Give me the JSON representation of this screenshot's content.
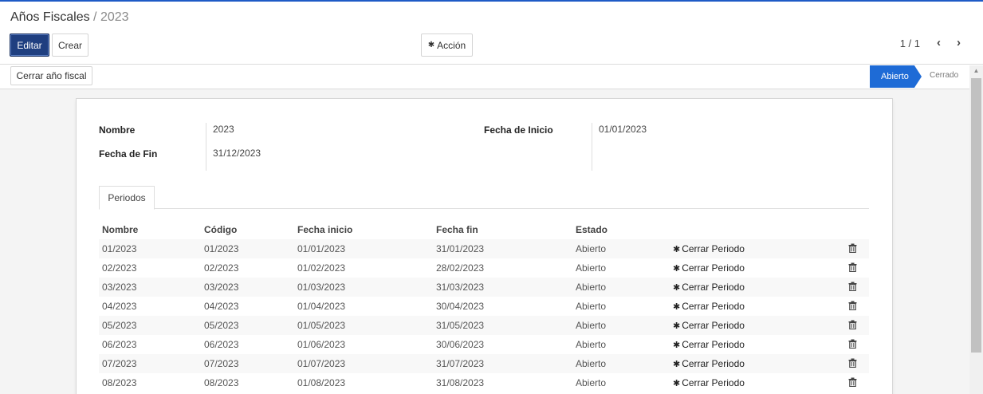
{
  "breadcrumb": {
    "parent": "Años Fiscales",
    "separator": "/",
    "current": "2023"
  },
  "toolbar": {
    "edit_label": "Editar",
    "create_label": "Crear",
    "action_label": "Acción",
    "action_icon": "gear-icon"
  },
  "pager": {
    "value": "1 / 1",
    "prev_icon": "chevron-left-icon",
    "next_icon": "chevron-right-icon"
  },
  "statusbar": {
    "close_year_label": "Cerrar año fiscal",
    "stages": [
      "Abierto",
      "Cerrado"
    ],
    "active_stage": "Abierto"
  },
  "form": {
    "name_label": "Nombre",
    "name_value": "2023",
    "end_label": "Fecha de Fin",
    "end_value": "31/12/2023",
    "start_label": "Fecha de Inicio",
    "start_value": "01/01/2023"
  },
  "tabs": [
    "Periodos"
  ],
  "table": {
    "columns": [
      "Nombre",
      "Código",
      "Fecha inicio",
      "Fecha fin",
      "Estado"
    ],
    "action_label": "Cerrar Periodo",
    "rows": [
      [
        "01/2023",
        "01/2023",
        "01/01/2023",
        "31/01/2023",
        "Abierto"
      ],
      [
        "02/2023",
        "02/2023",
        "01/02/2023",
        "28/02/2023",
        "Abierto"
      ],
      [
        "03/2023",
        "03/2023",
        "01/03/2023",
        "31/03/2023",
        "Abierto"
      ],
      [
        "04/2023",
        "04/2023",
        "01/04/2023",
        "30/04/2023",
        "Abierto"
      ],
      [
        "05/2023",
        "05/2023",
        "01/05/2023",
        "31/05/2023",
        "Abierto"
      ],
      [
        "06/2023",
        "06/2023",
        "01/06/2023",
        "30/06/2023",
        "Abierto"
      ],
      [
        "07/2023",
        "07/2023",
        "01/07/2023",
        "31/07/2023",
        "Abierto"
      ],
      [
        "08/2023",
        "08/2023",
        "01/08/2023",
        "31/08/2023",
        "Abierto"
      ]
    ]
  },
  "colors": {
    "primary": "#1f3f80",
    "status_active": "#1e6bd6",
    "top_accent": "#1e5bc6"
  }
}
